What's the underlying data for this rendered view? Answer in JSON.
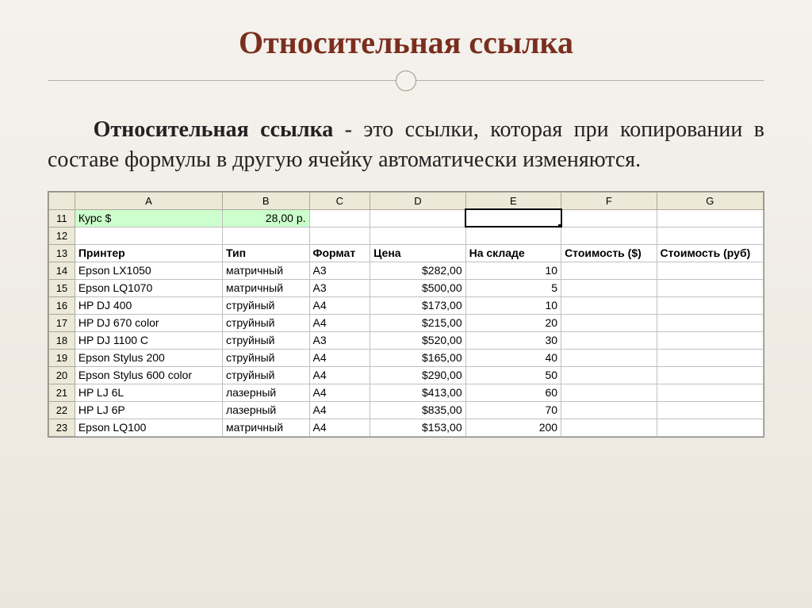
{
  "title": "Относительная ссылка",
  "paragraph_bold": "Относительная ссылка",
  "paragraph_rest": " - это ссылки, которая при копировании в составе формулы в другую ячейку автоматически изменяются.",
  "chart_data": {
    "type": "table",
    "columns": [
      "A",
      "B",
      "C",
      "D",
      "E",
      "F",
      "G"
    ],
    "row_numbers": [
      11,
      12,
      13,
      14,
      15,
      16,
      17,
      18,
      19,
      20,
      21,
      22,
      23
    ],
    "row11": {
      "A": "Курс $",
      "B": "28,00 р."
    },
    "headers_row13": {
      "A": "Принтер",
      "B": "Тип",
      "C": "Формат",
      "D": "Цена",
      "E": "На складе",
      "F": "Стоимость ($)",
      "G": "Стоимость (руб)"
    },
    "rows": [
      {
        "n": 14,
        "A": "Epson LX1050",
        "B": "матричный",
        "C": "A3",
        "D": "$282,00",
        "E": "10"
      },
      {
        "n": 15,
        "A": "Epson LQ1070",
        "B": "матричный",
        "C": "A3",
        "D": "$500,00",
        "E": "5"
      },
      {
        "n": 16,
        "A": "HP DJ 400",
        "B": "струйный",
        "C": "A4",
        "D": "$173,00",
        "E": "10"
      },
      {
        "n": 17,
        "A": "HP DJ 670 color",
        "B": "струйный",
        "C": "A4",
        "D": "$215,00",
        "E": "20"
      },
      {
        "n": 18,
        "A": "HP DJ 1100 C",
        "B": "струйный",
        "C": "A3",
        "D": "$520,00",
        "E": "30"
      },
      {
        "n": 19,
        "A": "Epson Stylus 200",
        "B": "струйный",
        "C": "A4",
        "D": "$165,00",
        "E": "40"
      },
      {
        "n": 20,
        "A": "Epson Stylus 600 color",
        "B": "струйный",
        "C": "A4",
        "D": "$290,00",
        "E": "50"
      },
      {
        "n": 21,
        "A": "HP LJ 6L",
        "B": "лазерный",
        "C": "A4",
        "D": "$413,00",
        "E": "60"
      },
      {
        "n": 22,
        "A": "HP LJ 6P",
        "B": "лазерный",
        "C": "A4",
        "D": "$835,00",
        "E": "70"
      },
      {
        "n": 23,
        "A": "Epson LQ100",
        "B": "матричный",
        "C": "A4",
        "D": "$153,00",
        "E": "200"
      }
    ],
    "selected_cell": "E11"
  }
}
